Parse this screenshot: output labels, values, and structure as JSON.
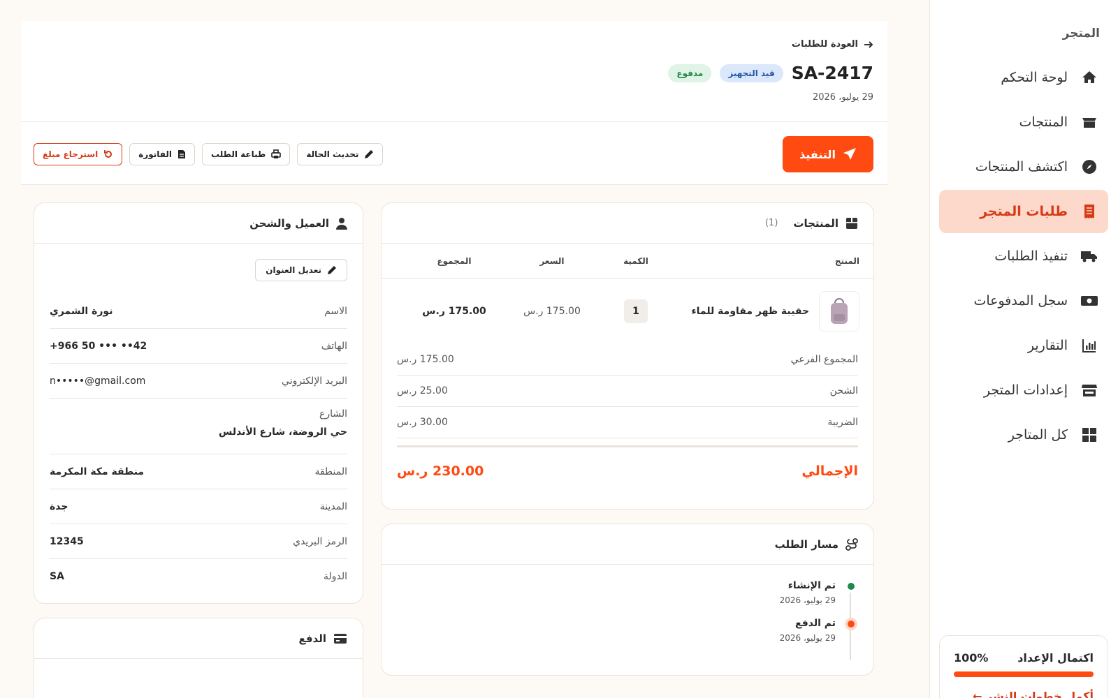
{
  "sidebar": {
    "store_label": "المتجر",
    "items": [
      {
        "label": "لوحة التحكم",
        "icon": "home-icon"
      },
      {
        "label": "المنتجات",
        "icon": "box-icon"
      },
      {
        "label": "اكتشف المنتجات",
        "icon": "compass-icon"
      },
      {
        "label": "طلبات المتجر",
        "icon": "receipt-icon",
        "active": true
      },
      {
        "label": "تنفيذ الطلبات",
        "icon": "truck-icon"
      },
      {
        "label": "سجل المدفوعات",
        "icon": "money-icon"
      },
      {
        "label": "التقارير",
        "icon": "chart-icon"
      },
      {
        "label": "إعدادات المتجر",
        "icon": "store-icon"
      },
      {
        "label": "كل المتاجر",
        "icon": "grid-icon"
      }
    ],
    "setup": {
      "title": "اكتمال الإعداد",
      "percent": "100%",
      "progress": 1.0,
      "link": "أكمل خطوات النشر ←"
    }
  },
  "header": {
    "back": "العودة للطلبات",
    "order_id": "SA-2417",
    "status_badge": "قيد التجهيز",
    "payment_badge": "مدفوع",
    "date": "29 يوليو، 2026"
  },
  "actions": {
    "fulfill": "التنفيذ",
    "refund": "استرجاع مبلغ",
    "invoice": "الفاتورة",
    "print": "طباعة الطلب",
    "update_status": "تحديث الحالة"
  },
  "products": {
    "title": "المنتجات",
    "count": "(1)",
    "columns": {
      "product": "المنتج",
      "qty": "الكمية",
      "price": "السعر",
      "total": "المجموع"
    },
    "rows": [
      {
        "name": "حقيبة ظهر مقاومة للماء",
        "qty": "1",
        "price": "175.00 ر.س",
        "total": "175.00 ر.س"
      }
    ],
    "subtotal_label": "المجموع الفرعي",
    "subtotal": "175.00 ر.س",
    "shipping_label": "الشحن",
    "shipping": "25.00 ر.س",
    "tax_label": "الضريبة",
    "tax": "30.00 ر.س",
    "grand_label": "الإجمالي",
    "grand": "230.00 ر.س"
  },
  "timeline": {
    "title": "مسار الطلب",
    "events": [
      {
        "title": "تم الإنشاء",
        "date": "29 يوليو، 2026",
        "color": "#1e8a48"
      },
      {
        "title": "تم الدفع",
        "date": "29 يوليو، 2026",
        "color": "#ff4a12"
      }
    ]
  },
  "customer": {
    "title": "العميل والشحن",
    "edit": "تعديل العنوان",
    "name_label": "الاسم",
    "name": "نورة الشمري",
    "phone_label": "الهاتف",
    "phone": "+966 50 ••• ••42",
    "email_label": "البريد الإلكتروني",
    "email": "n•••••@gmail.com",
    "street_label": "الشارع",
    "street": "حي الروضة، شارع الأندلس",
    "region_label": "المنطقة",
    "region": "منطقة مكة المكرمة",
    "city_label": "المدينة",
    "city": "جدة",
    "zip_label": "الرمز البريدي",
    "zip": "12345",
    "country_label": "الدولة",
    "country": "SA"
  },
  "payment": {
    "title": "الدفع"
  }
}
